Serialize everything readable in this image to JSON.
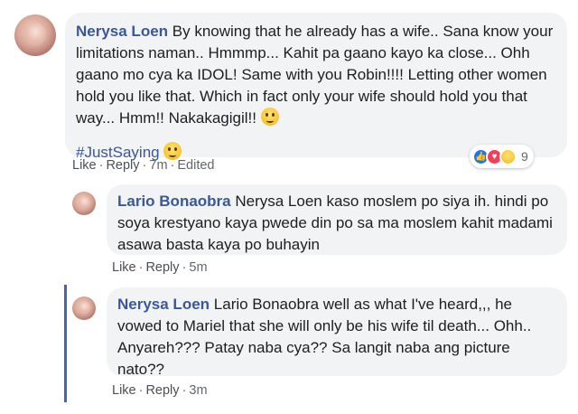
{
  "comments": [
    {
      "author": "Nerysa Loen",
      "text": "By knowing that he already has a wife.. Sana know your limitations naman.. Hmmmp... Kahit pa gaano kayo ka close... Ohh gaano mo cya ka IDOL! Same with you Robin!!!! Letting other women hold you like that. Which in fact only your wife should hold you that way... Hmm!! Nakakagigil!!",
      "hashtag": "#JustSaying",
      "like_label": "Like",
      "reply_label": "Reply",
      "time": "7m",
      "edited_label": "Edited",
      "reaction_count": "9"
    },
    {
      "author": "Lario Bonaobra",
      "text": "Nerysa Loen kaso moslem po siya ih. hindi po soya krestyano kaya pwede din po sa ma moslem kahit madami asawa basta kaya po buhayin",
      "like_label": "Like",
      "reply_label": "Reply",
      "time": "5m"
    },
    {
      "author": "Nerysa Loen",
      "text": "Lario Bonaobra well as what I've heard,,, he vowed to Mariel that she will only be his wife til death... Ohh.. Anyareh??? Patay naba cya?? Sa langit naba ang picture nato??",
      "like_label": "Like",
      "reply_label": "Reply",
      "time": "3m"
    }
  ],
  "colors": {
    "link": "#385898",
    "bubble": "#f2f3f5",
    "thread_line": "#4267b2"
  }
}
